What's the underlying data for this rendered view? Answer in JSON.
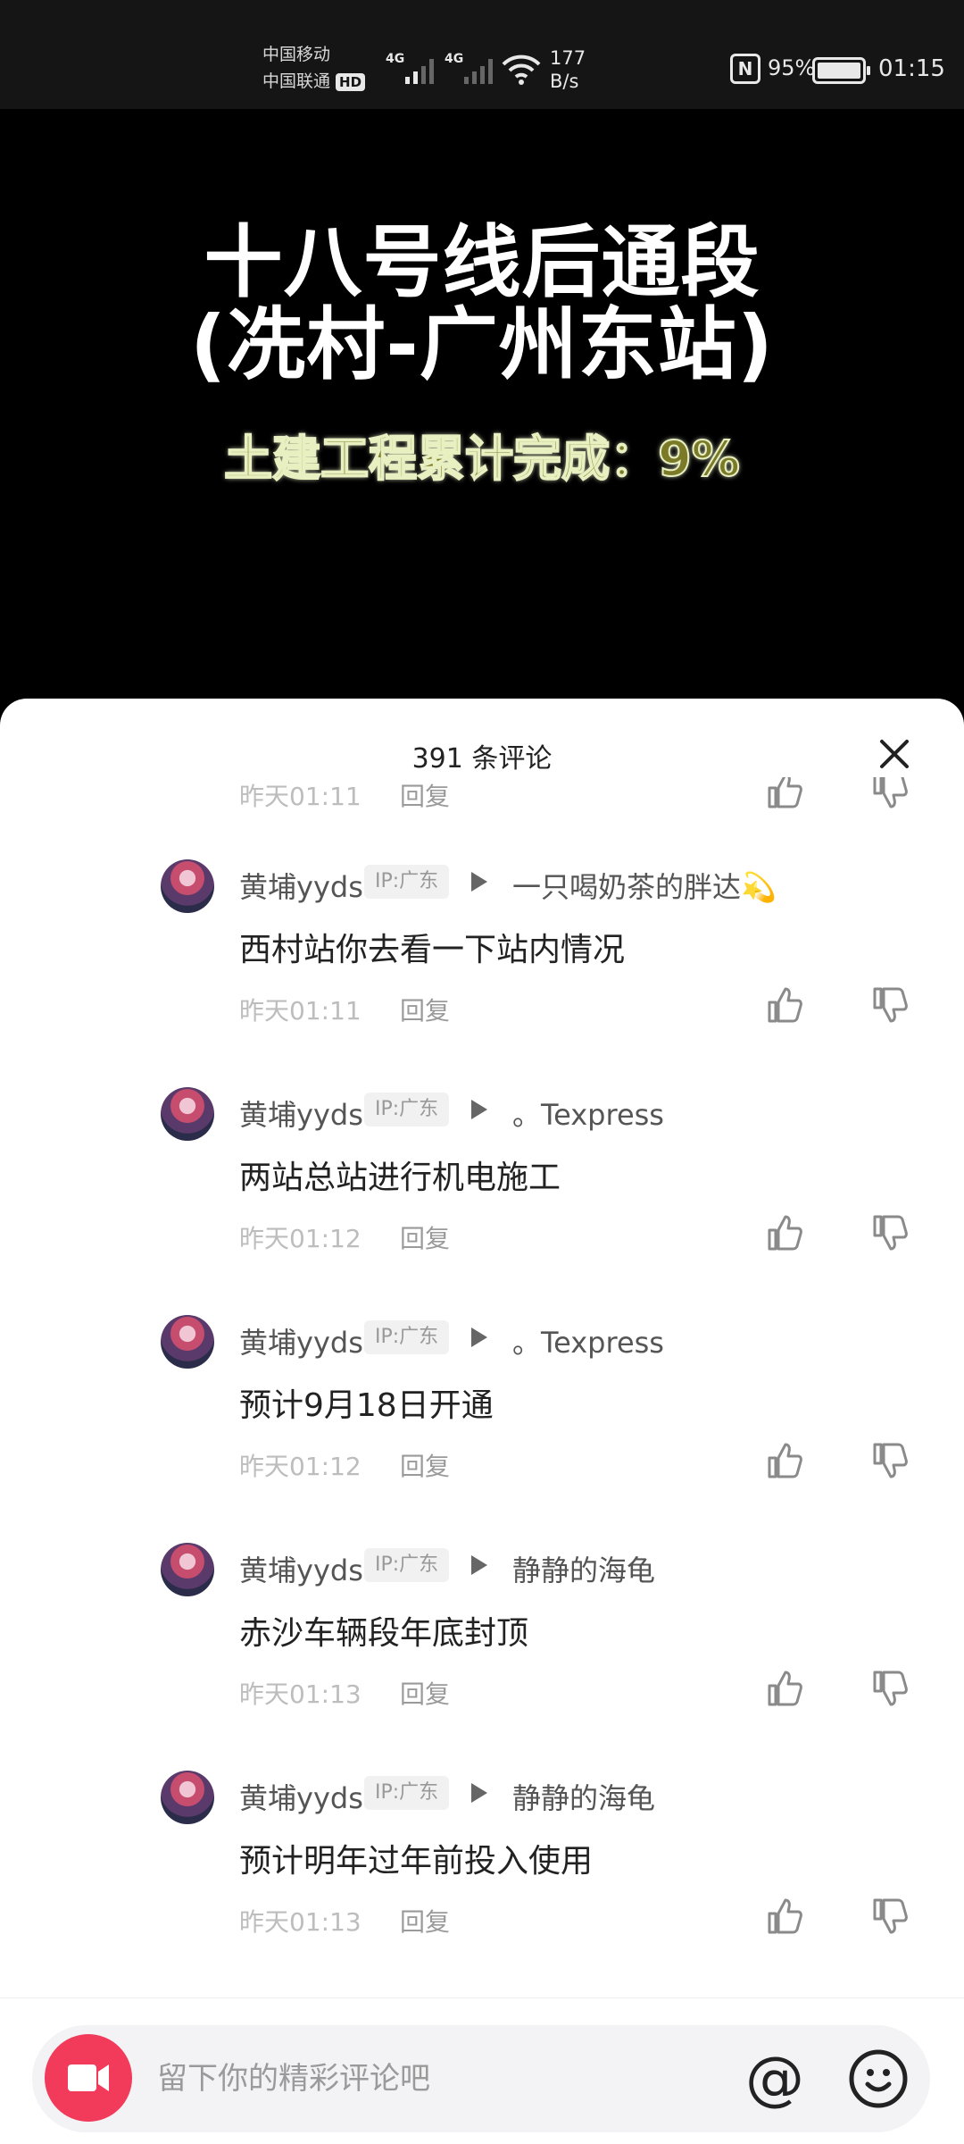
{
  "status_bar": {
    "carrier1": "中国移动",
    "carrier2": "中国联通",
    "hd": "HD",
    "net1": "4G",
    "net2": "4G",
    "speed_value": "177",
    "speed_unit": "B/s",
    "nfc": "N",
    "battery": "95%",
    "battery_level": 0.95,
    "time": "01:15"
  },
  "video": {
    "title_line1": "十八号线后通段",
    "title_line2": "(冼村-广州东站)",
    "subtitle": "土建工程累计完成：9%"
  },
  "sheet": {
    "title": "391 条评论",
    "partial": {
      "time": "昨天01:11",
      "reply": "回复"
    },
    "comments": [
      {
        "author": "黄埔yyds",
        "ip": "IP:广东",
        "reply_to": "一只喝奶茶的胖达💫",
        "text": "西村站你去看一下站内情况",
        "time": "昨天01:11",
        "reply": "回复"
      },
      {
        "author": "黄埔yyds",
        "ip": "IP:广东",
        "reply_to": "。Texpress",
        "text": "两站总站进行机电施工",
        "time": "昨天01:12",
        "reply": "回复"
      },
      {
        "author": "黄埔yyds",
        "ip": "IP:广东",
        "reply_to": "。Texpress",
        "text": "预计9月18日开通",
        "time": "昨天01:12",
        "reply": "回复"
      },
      {
        "author": "黄埔yyds",
        "ip": "IP:广东",
        "reply_to": "静静的海龟",
        "text": "赤沙车辆段年底封顶",
        "time": "昨天01:13",
        "reply": "回复"
      },
      {
        "author": "黄埔yyds",
        "ip": "IP:广东",
        "reply_to": "静静的海龟",
        "text": "预计明年过年前投入使用",
        "time": "昨天01:13",
        "reply": "回复"
      }
    ]
  },
  "input": {
    "placeholder": "留下你的精彩评论吧",
    "mention": "@"
  },
  "icons": {
    "close": "close-icon",
    "like": "thumbs-up-icon",
    "dislike": "thumbs-down-icon",
    "record": "video-camera-icon",
    "emoji": "smiley-icon",
    "wifi": "wifi-icon"
  },
  "colors": {
    "accent": "#f23a5a",
    "subtitle_fill": "#7a7a28",
    "subtitle_glow": "#e8efc0"
  }
}
